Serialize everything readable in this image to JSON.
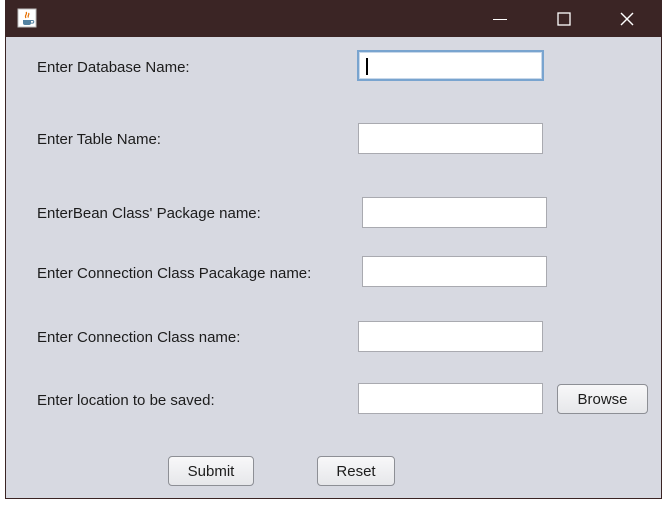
{
  "window": {
    "icon": "java-cup-icon",
    "controls": {
      "minimize": "minimize-icon",
      "maximize": "maximize-icon",
      "close": "close-icon"
    }
  },
  "form": {
    "database_name_label": "Enter Database Name:",
    "database_name_value": "",
    "table_name_label": "Enter Table  Name:",
    "table_name_value": "",
    "bean_package_label": "EnterBean Class' Package name:",
    "bean_package_value": "",
    "connection_package_label": "Enter Connection Class Pacakage name:",
    "connection_package_value": "",
    "connection_class_label": "Enter Connection Class name:",
    "connection_class_value": "",
    "location_label": "Enter location to be saved:",
    "location_value": "",
    "browse_label": "Browse",
    "submit_label": "Submit",
    "reset_label": "Reset"
  },
  "colors": {
    "titlebar": "#3b2525",
    "panel": "#d7d9e1",
    "focus_border": "#79a4cf"
  }
}
